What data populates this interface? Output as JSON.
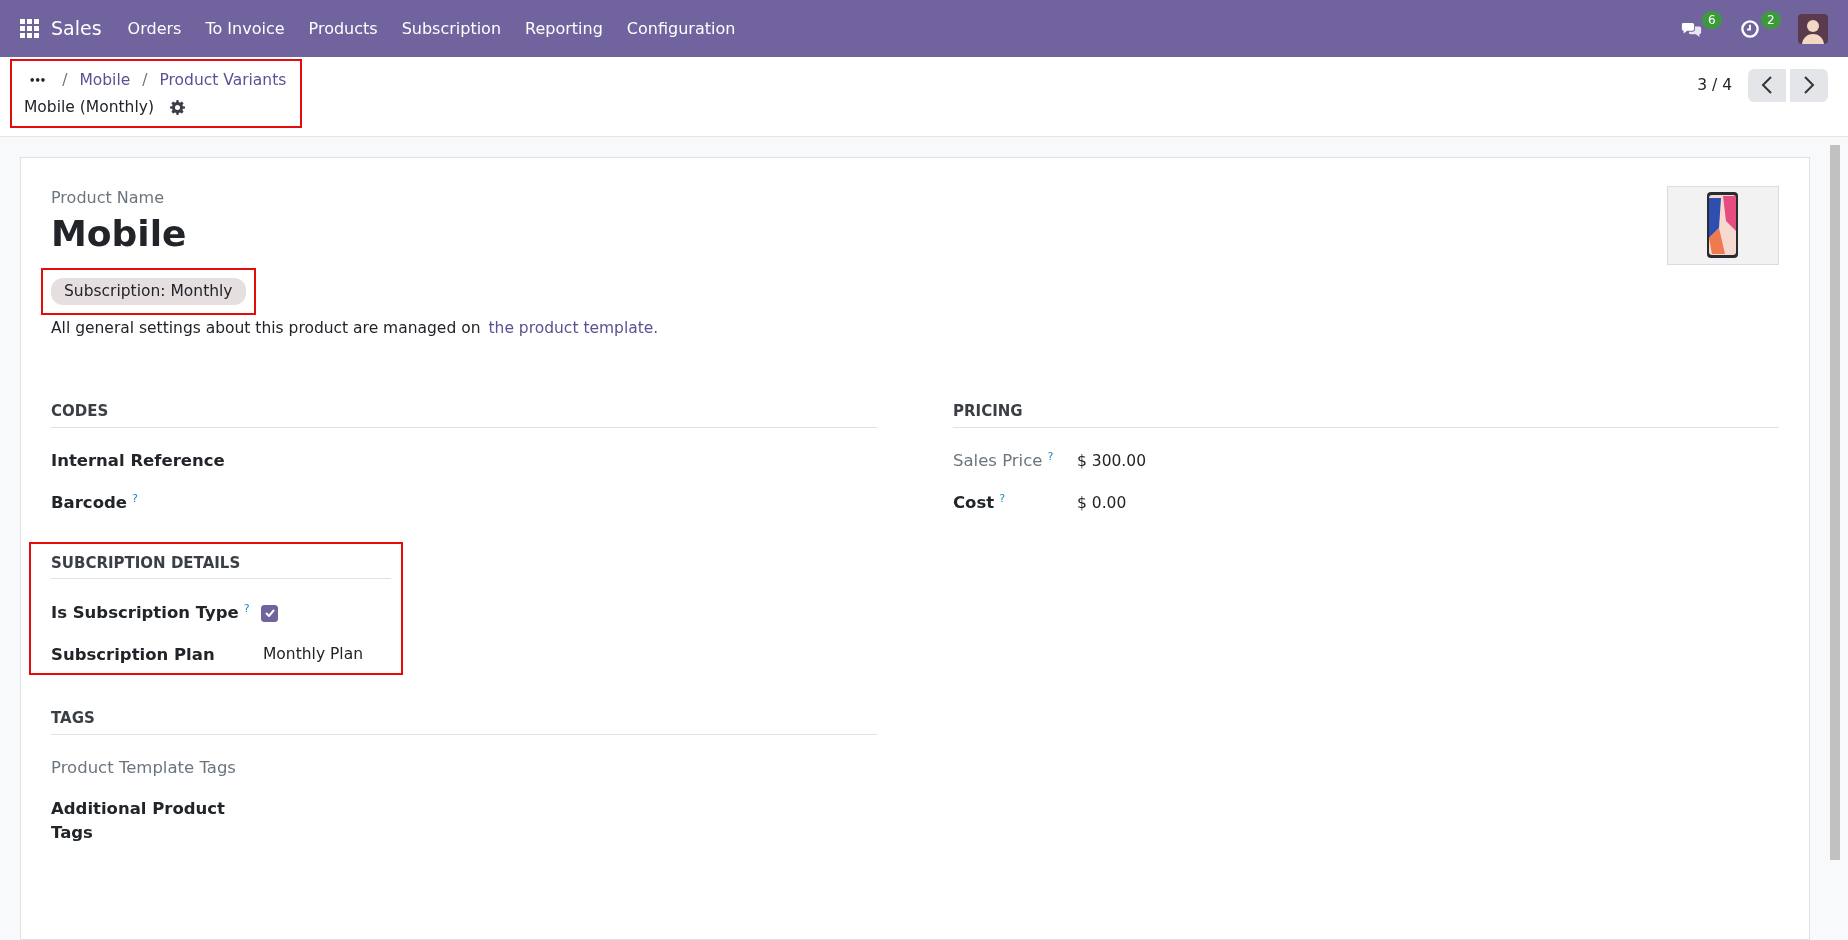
{
  "navbar": {
    "app": "Sales",
    "menu": [
      "Orders",
      "To Invoice",
      "Products",
      "Subscription",
      "Reporting",
      "Configuration"
    ],
    "messages_count": "6",
    "activities_count": "2"
  },
  "breadcrumb": {
    "more": "•••",
    "separator": "/",
    "items": [
      "Mobile",
      "Product Variants"
    ],
    "current": "Mobile (Monthly)",
    "highlighted": true
  },
  "pager": {
    "text": "3 / 4"
  },
  "form": {
    "name_label": "Product Name",
    "name": "Mobile",
    "tag": {
      "text": "Subscription: Monthly",
      "highlighted": true
    },
    "note": {
      "text": "All general settings about this product are managed on",
      "link": "the product template."
    },
    "groups": [
      {
        "sections": [
          {
            "title": "CODES",
            "fields": [
              {
                "kind": "text",
                "label": "Internal Reference"
              },
              {
                "kind": "text",
                "label": "Barcode",
                "help": "?"
              }
            ]
          },
          {
            "title": "PRICING",
            "fields": [
              {
                "kind": "text",
                "label": "Sales Price",
                "help": "?",
                "value": "$ 300.00",
                "readonly": true
              },
              {
                "kind": "text",
                "label": "Cost",
                "help": "?",
                "value": "$ 0.00"
              }
            ]
          }
        ]
      },
      {
        "sections": [
          {
            "title": "SUBCRIPTION DETAILS",
            "highlighted": true,
            "fields": [
              {
                "kind": "checkbox",
                "label": "Is Subscription Type",
                "help": "?",
                "checked": true
              },
              {
                "kind": "text",
                "label": "Subscription Plan",
                "value": "Monthly Plan"
              }
            ]
          }
        ]
      },
      {
        "sections": [
          {
            "title": "TAGS",
            "fields": [
              {
                "kind": "text",
                "label": "Product Template Tags",
                "readonly": true
              },
              {
                "kind": "text",
                "label": "Additional Product Tags"
              }
            ]
          }
        ]
      }
    ]
  }
}
